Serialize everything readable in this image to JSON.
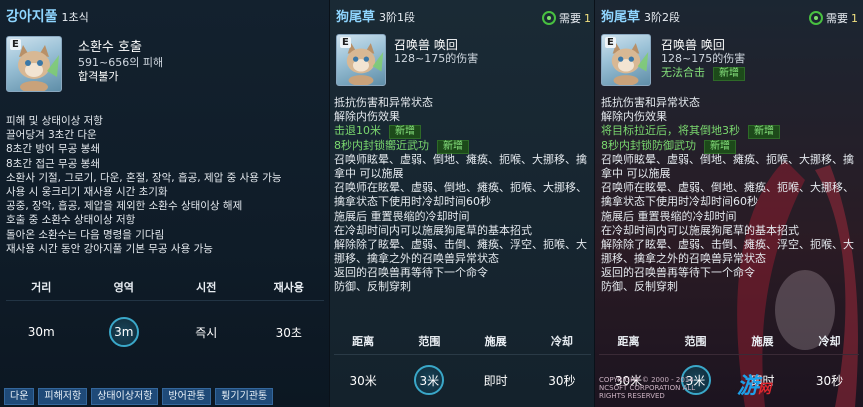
{
  "panel1": {
    "title": "강아지풀",
    "rank": "1초식",
    "icon_tag": "E",
    "skill_type": "소환수 호출",
    "damage": "591~656의 피해",
    "grade": "합격불가",
    "desc": [
      "피해 및 상태이상 저항",
      "끌어당겨 3초간 다운",
      "8초간 방어 무공 봉쇄",
      "8초간 접근 무공 봉쇄",
      "소환사 기절, 그로기, 다운, 혼절, 장악, 흡공, 제압 중 사용 가능",
      "사용 시 웅크리기 재사용 시간 초기화",
      "공중, 장악, 흡공, 제압을 제외한 소환수 상태이상 해제",
      "호출 중 소환수 상태이상 저항",
      "돌아온 소환수는 다음 명령을 기다림",
      "재사용 시간 동안 강아지풀 기본 무공 사용 가능"
    ],
    "stat_labels": [
      "거리",
      "영역",
      "시전",
      "재사용"
    ],
    "stat_values": [
      "30m",
      "3m",
      "즉시",
      "30초"
    ],
    "tags": [
      "다운",
      "피해저항",
      "상태이상저항",
      "방어관통",
      "튕기기관통"
    ]
  },
  "panel2": {
    "title": "狗尾草",
    "rank": "3阶1段",
    "need_label": "需要",
    "need_num": "1",
    "icon_tag": "E",
    "skill_type": "召唤兽 唤回",
    "damage": "128~175的伤害",
    "desc_lines": [
      {
        "t": "抵抗伤害和异常状态",
        "g": false
      },
      {
        "t": "解除内伤效果",
        "g": false
      },
      {
        "t": "击退10米",
        "g": true,
        "badge": "新增"
      },
      {
        "t": "8秒内封锁嚮近武功",
        "g": true,
        "badge": "新增"
      },
      {
        "t": "召唤师眩晕、虚弱、倒地、瘫痪、扼喉、大挪移、擒",
        "g": false
      },
      {
        "t": "拿中 可以施展",
        "g": false
      },
      {
        "t": "召唤师在眩晕、虚弱、倒地、瘫痪、扼喉、大挪移、",
        "g": false
      },
      {
        "t": "擒拿状态下使用时冷却时间60秒",
        "g": false
      },
      {
        "t": "施展后 重置畏缩的冷却时间",
        "g": false
      },
      {
        "t": "在冷却时间内可以施展狗尾草的基本招式",
        "g": false
      },
      {
        "t": "解除除了眩晕、虚弱、击倒、瘫痪、浮空、扼喉、大",
        "g": false
      },
      {
        "t": "挪移、擒拿之外的召唤兽异常状态",
        "g": false
      },
      {
        "t": "返回的召唤兽再等待下一个命令",
        "g": false
      },
      {
        "t": "防御、反制穿刺",
        "g": false
      }
    ],
    "stat_labels": [
      "距离",
      "范围",
      "施展",
      "冷却"
    ],
    "stat_values": [
      "30米",
      "3米",
      "即时",
      "30秒"
    ]
  },
  "panel3": {
    "title": "狗尾草",
    "rank": "3阶2段",
    "need_label": "需要",
    "need_num": "1",
    "icon_tag": "E",
    "skill_type": "召唤兽 唤回",
    "damage": "128~175的伤害",
    "combo": "无法合击",
    "combo_badge": "新增",
    "desc_lines": [
      {
        "t": "抵抗伤害和异常状态",
        "g": false
      },
      {
        "t": "解除内伤效果",
        "g": false
      },
      {
        "t": "将目标拉近后，将其倒地3秒",
        "g": true,
        "badge": "新增"
      },
      {
        "t": "8秒内封锁防御武功",
        "g": true,
        "badge": "新增"
      },
      {
        "t": "召唤师眩晕、虚弱、倒地、瘫痪、扼喉、大挪移、擒",
        "g": false
      },
      {
        "t": "拿中 可以施展",
        "g": false
      },
      {
        "t": "召唤师在眩晕、虚弱、倒地、瘫痪、扼喉、大挪移、",
        "g": false
      },
      {
        "t": "擒拿状态下使用时冷却时间60秒",
        "g": false
      },
      {
        "t": "施展后 重置畏缩的冷却时间",
        "g": false
      },
      {
        "t": "在冷却时间内可以施展狗尾草的基本招式",
        "g": false
      },
      {
        "t": "解除除了眩晕、虚弱、击倒、瘫痪、浮空、扼喉、大",
        "g": false
      },
      {
        "t": "挪移、擒拿之外的召唤兽异常状态",
        "g": false
      },
      {
        "t": "返回的召唤兽再等待下一个命令",
        "g": false
      },
      {
        "t": "防御、反制穿刺",
        "g": false
      }
    ],
    "stat_labels": [
      "距离",
      "范围",
      "施展",
      "冷却"
    ],
    "stat_values": [
      "30米",
      "3米",
      "即时",
      "30秒"
    ],
    "watermark": "游",
    "watermark_suffix": "网",
    "copyright": "COPYRIGHT © 2000 - 2014 NCSOFT CORPORATION ALL RIGHTS RESERVED"
  },
  "colors": {
    "title_blue": "#8fd6ff",
    "green_text": "#7ad86e",
    "tag_blue": "#1f4a78",
    "circle_border": "#3aa7c8"
  }
}
